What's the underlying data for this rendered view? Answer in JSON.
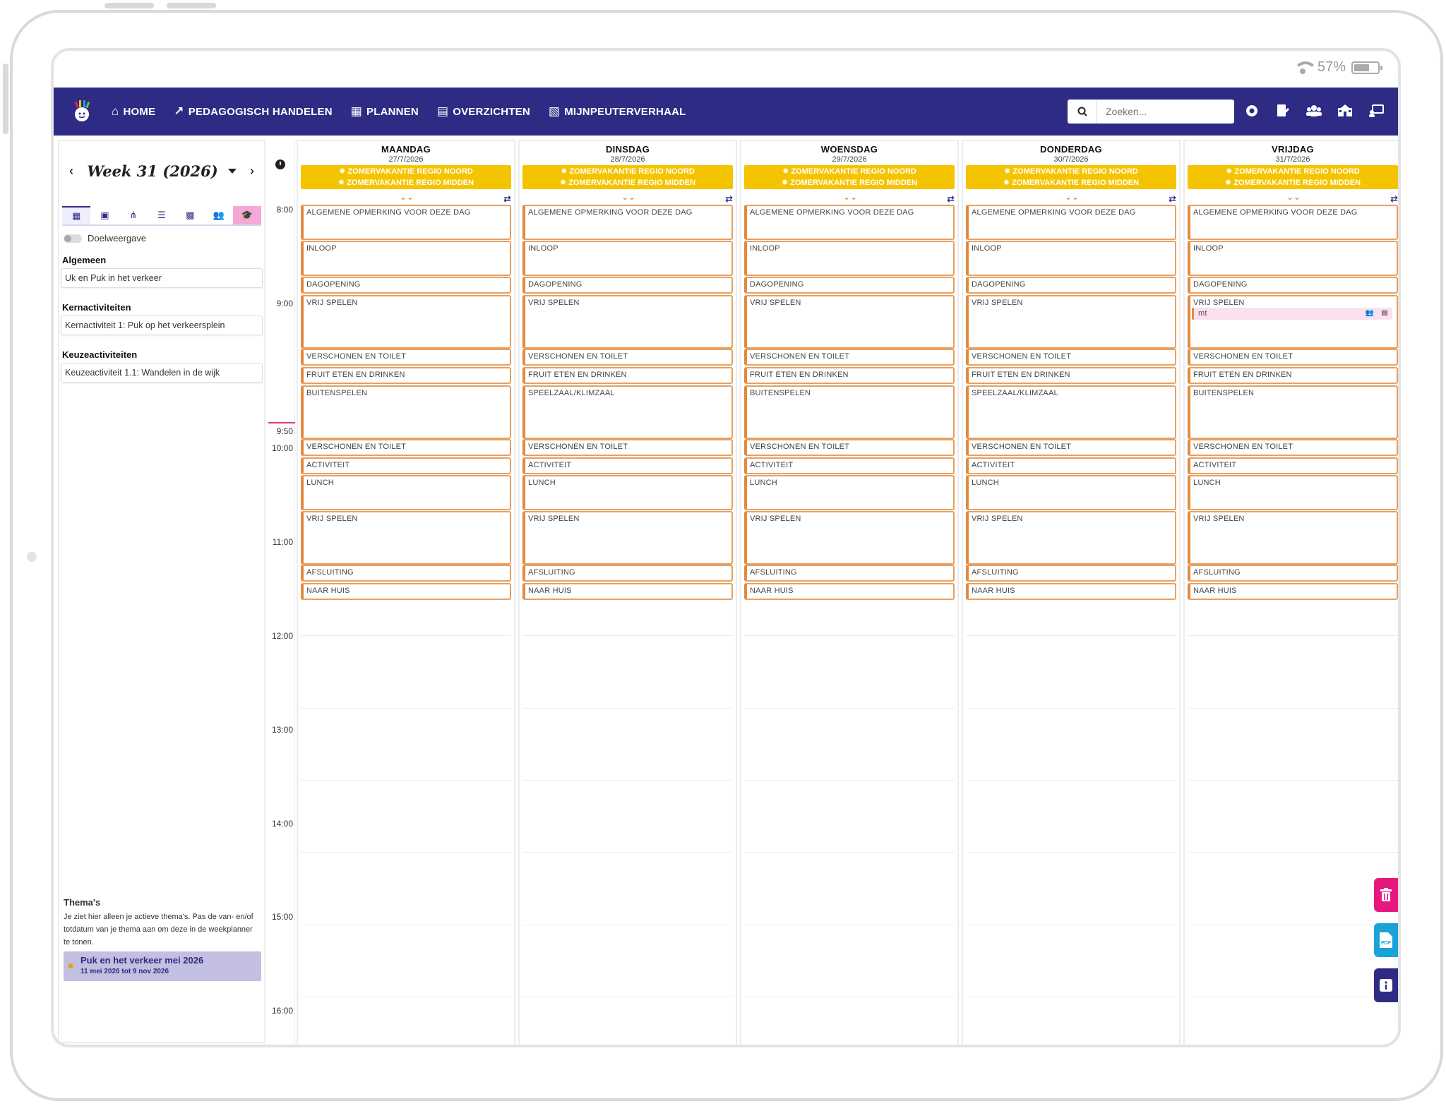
{
  "status": {
    "battery_label": "57%",
    "battery_level": 0.57
  },
  "nav": {
    "items": [
      {
        "label": "HOME",
        "icon": "home-icon",
        "glyph": "⌂"
      },
      {
        "label": "PEDAGOGISCH HANDELEN",
        "icon": "chart-line-icon",
        "glyph": "📈"
      },
      {
        "label": "PLANNEN",
        "icon": "calendar-icon",
        "glyph": "▦"
      },
      {
        "label": "OVERZICHTEN",
        "icon": "document-icon",
        "glyph": "▤"
      },
      {
        "label": "MIJNPEUTERVERHAAL",
        "icon": "pdf-file-icon",
        "glyph": "▧"
      }
    ],
    "search_placeholder": "Zoeken...",
    "right_icons": [
      "record-icon",
      "edit-document-icon",
      "users-icon",
      "school-icon",
      "screen-share-icon"
    ]
  },
  "sidebar": {
    "week_title": "Week 31 (2026)",
    "tabs": [
      "calendar-icon",
      "calendar-day-icon",
      "sitemap-icon",
      "list-icon",
      "calendar-check-icon",
      "users-icon",
      "graduation-cap-icon"
    ],
    "toggle_label": "Doelweergave",
    "sections": [
      {
        "heading": "Algemeen",
        "item": "Uk en Puk in het verkeer"
      },
      {
        "heading": "Kernactiviteiten",
        "item": "Kernactiviteit 1: Puk op het verkeersplein"
      },
      {
        "heading": "Keuzeactiviteiten",
        "item": "Keuzeactiviteit 1.1: Wandelen in de wijk"
      }
    ],
    "themas": {
      "heading": "Thema's",
      "note": "Je ziet hier alleen je actieve thema's. Pas de van- en/of totdatum van je thema aan om deze in de weekplanner te tonen.",
      "theme_title": "Puk en het verkeer mei 2026",
      "theme_dates": "11 mei 2026 tot 9 nov 2026"
    }
  },
  "times": [
    "8:00",
    "9:00",
    "9:50",
    "10:00",
    "11:00",
    "12:00",
    "13:00",
    "14:00",
    "15:00",
    "16:00"
  ],
  "vacations": [
    "ZOMERVAKANTIE REGIO NOORD",
    "ZOMERVAKANTIE REGIO MIDDEN"
  ],
  "days": [
    {
      "name": "MAANDAG",
      "date": "27/7/2026",
      "blocks": [
        "ALGEMENE OPMERKING VOOR DEZE DAG",
        "INLOOP",
        "DAGOPENING",
        "VRIJ SPELEN",
        "VERSCHONEN EN TOILET",
        "FRUIT ETEN EN DRINKEN",
        "BUITENSPELEN",
        "VERSCHONEN EN TOILET",
        "ACTIVITEIT",
        "LUNCH",
        "VRIJ SPELEN",
        "AFSLUITING",
        "NAAR HUIS"
      ]
    },
    {
      "name": "DINSDAG",
      "date": "28/7/2026",
      "blocks": [
        "ALGEMENE OPMERKING VOOR DEZE DAG",
        "INLOOP",
        "DAGOPENING",
        "VRIJ SPELEN",
        "VERSCHONEN EN TOILET",
        "FRUIT ETEN EN DRINKEN",
        "SPEELZAAL/KLIMZAAL",
        "VERSCHONEN EN TOILET",
        "ACTIVITEIT",
        "LUNCH",
        "VRIJ SPELEN",
        "AFSLUITING",
        "NAAR HUIS"
      ]
    },
    {
      "name": "WOENSDAG",
      "date": "29/7/2026",
      "blocks": [
        "ALGEMENE OPMERKING VOOR DEZE DAG",
        "INLOOP",
        "DAGOPENING",
        "VRIJ SPELEN",
        "VERSCHONEN EN TOILET",
        "FRUIT ETEN EN DRINKEN",
        "BUITENSPELEN",
        "VERSCHONEN EN TOILET",
        "ACTIVITEIT",
        "LUNCH",
        "VRIJ SPELEN",
        "AFSLUITING",
        "NAAR HUIS"
      ]
    },
    {
      "name": "DONDERDAG",
      "date": "30/7/2026",
      "blocks": [
        "ALGEMENE OPMERKING VOOR DEZE DAG",
        "INLOOP",
        "DAGOPENING",
        "VRIJ SPELEN",
        "VERSCHONEN EN TOILET",
        "FRUIT ETEN EN DRINKEN",
        "SPEELZAAL/KLIMZAAL",
        "VERSCHONEN EN TOILET",
        "ACTIVITEIT",
        "LUNCH",
        "VRIJ SPELEN",
        "AFSLUITING",
        "NAAR HUIS"
      ]
    },
    {
      "name": "VRIJDAG",
      "date": "31/7/2026",
      "blocks": [
        "ALGEMENE OPMERKING VOOR DEZE DAG",
        "INLOOP",
        "DAGOPENING",
        "VRIJ SPELEN",
        "VERSCHONEN EN TOILET",
        "FRUIT ETEN EN DRINKEN",
        "BUITENSPELEN",
        "VERSCHONEN EN TOILET",
        "ACTIVITEIT",
        "LUNCH",
        "VRIJ SPELEN",
        "AFSLUITING",
        "NAAR HUIS"
      ],
      "event": {
        "label": "mt",
        "icons": [
          "users-icon",
          "document-icon"
        ]
      }
    }
  ],
  "fabs": [
    {
      "name": "delete-button",
      "icon": "trash-icon",
      "color": "#e6187e",
      "glyph": "🗑"
    },
    {
      "name": "pdf-export-button",
      "icon": "pdf-icon",
      "color": "#1aa3d9",
      "glyph": "PDF"
    },
    {
      "name": "info-button",
      "icon": "info-icon",
      "color": "#2e2b84",
      "glyph": "i"
    }
  ],
  "colors": {
    "nav": "#2e2b84",
    "vacation": "#f5c400",
    "block_border": "#e38a3c",
    "active_tab": "#f3a8d8"
  }
}
